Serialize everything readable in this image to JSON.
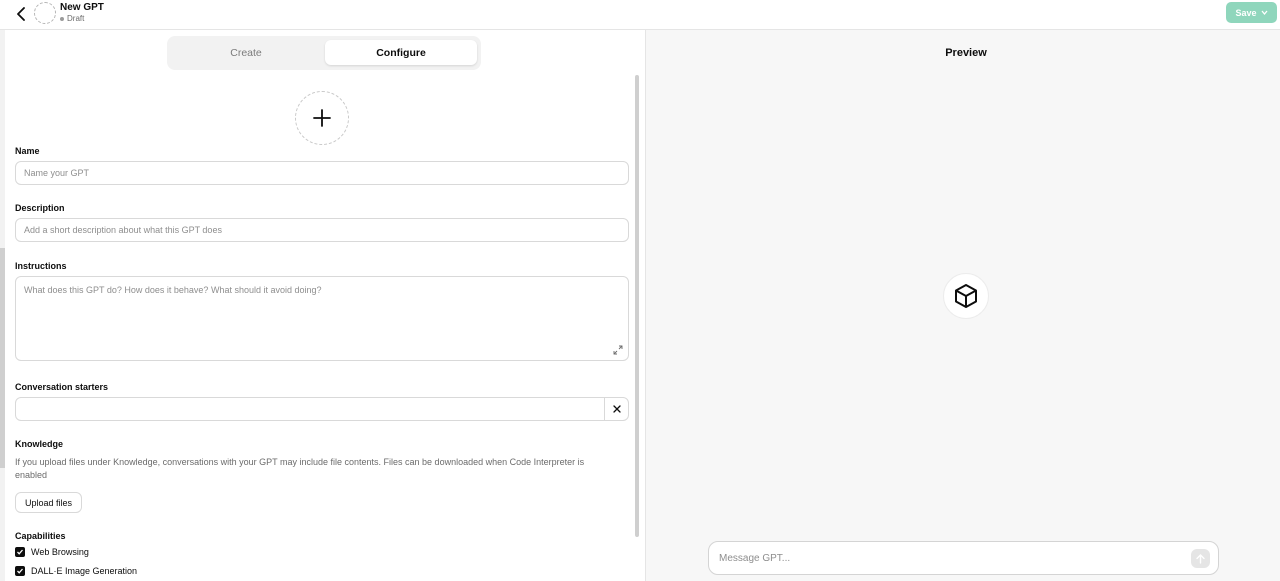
{
  "header": {
    "title": "New GPT",
    "status": "Draft",
    "save_label": "Save"
  },
  "tabs": [
    {
      "label": "Create",
      "active": false
    },
    {
      "label": "Configure",
      "active": true
    }
  ],
  "form": {
    "name_label": "Name",
    "name_placeholder": "Name your GPT",
    "description_label": "Description",
    "description_placeholder": "Add a short description about what this GPT does",
    "instructions_label": "Instructions",
    "instructions_placeholder": "What does this GPT do? How does it behave? What should it avoid doing?",
    "starters_label": "Conversation starters",
    "starter_value": "",
    "knowledge_label": "Knowledge",
    "knowledge_desc": "If you upload files under Knowledge, conversations with your GPT may include file contents. Files can be downloaded when Code Interpreter is enabled",
    "upload_label": "Upload files",
    "capabilities_label": "Capabilities",
    "capabilities": [
      {
        "label": "Web Browsing",
        "checked": true
      },
      {
        "label": "DALL·E Image Generation",
        "checked": true
      }
    ]
  },
  "preview": {
    "title": "Preview",
    "message_placeholder": "Message GPT..."
  },
  "colors": {
    "save_bg": "#8fd6bc",
    "panel_bg": "#f7f7f7"
  },
  "icons": {
    "back": "chevron-left-icon",
    "add": "plus-icon",
    "logo": "cube-icon",
    "send": "arrow-up-icon",
    "expand": "expand-icon",
    "remove": "close-icon"
  }
}
